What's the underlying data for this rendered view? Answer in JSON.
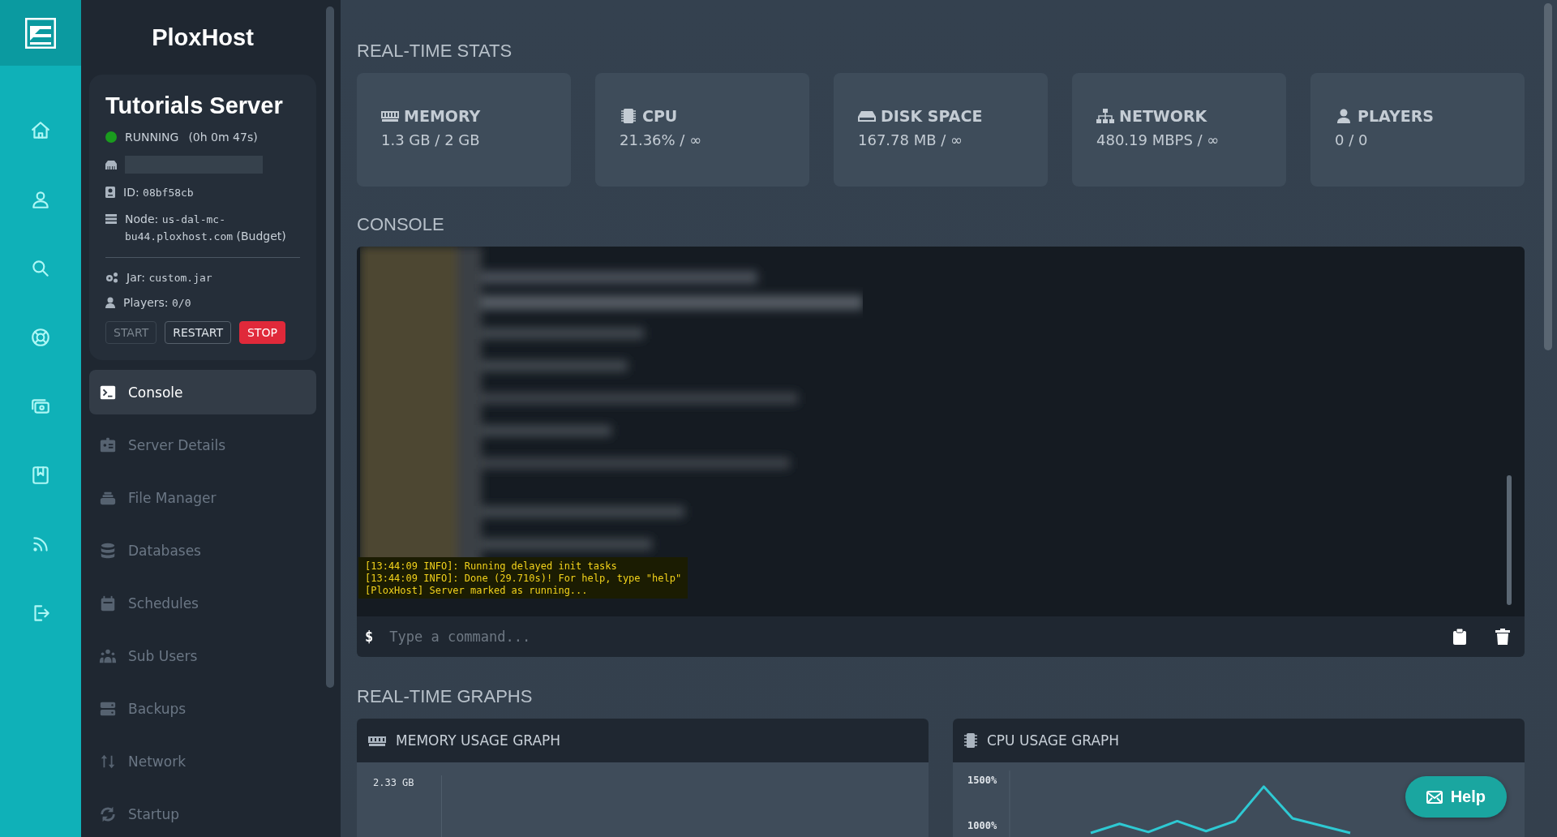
{
  "rail": {
    "items": [
      {
        "kind": "home",
        "selected": false
      },
      {
        "kind": "user",
        "selected": false
      },
      {
        "kind": "search",
        "selected": false
      },
      {
        "kind": "lifebuoy",
        "selected": false
      },
      {
        "kind": "money",
        "selected": false
      },
      {
        "kind": "bookmark",
        "selected": false
      },
      {
        "kind": "feed",
        "selected": false
      },
      {
        "kind": "logout",
        "selected": false
      }
    ]
  },
  "sidebar": {
    "brand": "PloxHost",
    "server": {
      "name": "Tutorials Server",
      "status": "RUNNING",
      "uptime": "(0h 0m 47s)",
      "running": true,
      "id_label": "ID:",
      "id": "08bf58cb",
      "node_label": "Node:",
      "node": "us-dal-mc-bu44.ploxhost.com",
      "node_tier": "(Budget)",
      "jar_label": "Jar:",
      "jar": "custom.jar",
      "players_label": "Players:",
      "players": "0/0",
      "buttons": [
        {
          "label": "START",
          "kind": "start",
          "disabled": true
        },
        {
          "label": "RESTART",
          "kind": "restart",
          "disabled": false
        },
        {
          "label": "STOP",
          "kind": "stop",
          "disabled": false
        }
      ]
    },
    "items": [
      {
        "label": "Console",
        "kind": "terminal",
        "selected": true
      },
      {
        "label": "Server Details",
        "kind": "idcard",
        "selected": false
      },
      {
        "label": "File Manager",
        "kind": "stack",
        "selected": false
      },
      {
        "label": "Databases",
        "kind": "database",
        "selected": false
      },
      {
        "label": "Schedules",
        "kind": "calendar",
        "selected": false
      },
      {
        "label": "Sub Users",
        "kind": "users",
        "selected": false
      },
      {
        "label": "Backups",
        "kind": "server",
        "selected": false
      },
      {
        "label": "Network",
        "kind": "arrows",
        "selected": false
      },
      {
        "label": "Startup",
        "kind": "refresh",
        "selected": false
      }
    ]
  },
  "stats": {
    "heading": "REAL-TIME STATS",
    "cards": [
      {
        "kind": "memory",
        "label": "MEMORY",
        "value": "1.3 GB / 2 GB"
      },
      {
        "kind": "cpu",
        "label": "CPU",
        "value": "21.36% / ∞"
      },
      {
        "kind": "disk",
        "label": "DISK SPACE",
        "value": "167.78 MB / ∞"
      },
      {
        "kind": "network",
        "label": "NETWORK",
        "value": "480.19 MBPS / ∞"
      },
      {
        "kind": "players",
        "label": "PLAYERS",
        "value": "0 / 0"
      }
    ]
  },
  "console": {
    "heading": "CONSOLE",
    "lines": [
      "[13:44:09 INFO]: Running delayed init tasks",
      "[13:44:09 INFO]: Done (29.710s)! For help, type \"help\"",
      "[PloxHost] Server marked as running..."
    ],
    "prompt": "$",
    "placeholder": "Type a command..."
  },
  "graphs": {
    "heading": "REAL-TIME GRAPHS",
    "memory": {
      "title": "MEMORY USAGE GRAPH",
      "tick_label": "2.33 GB"
    },
    "cpu": {
      "title": "CPU USAGE GRAPH",
      "tick_labels": [
        "1500%",
        "1000%"
      ]
    }
  },
  "help": {
    "label": "Help"
  }
}
